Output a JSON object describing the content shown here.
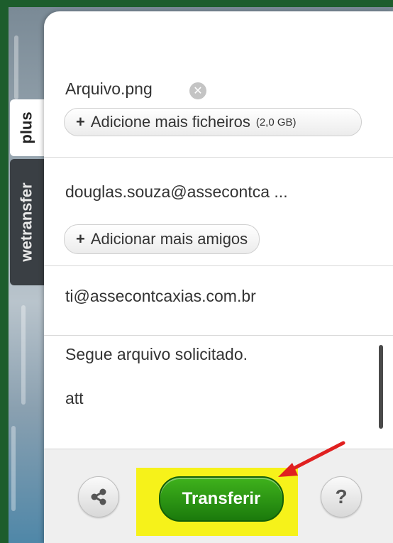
{
  "side_tabs": {
    "plus": "plus",
    "wetransfer": "wetransfer"
  },
  "files": {
    "file_name": "Arquivo.png",
    "add_label": "Adicione mais ficheiros",
    "add_prefix": "+",
    "size_limit": "(2,0 GB)"
  },
  "recipients": {
    "email": "douglas.souza@assecontca ...",
    "add_label": "Adicionar mais amigos",
    "add_prefix": "+"
  },
  "sender": {
    "email": "ti@assecontcaxias.com.br"
  },
  "message": {
    "line1": "Segue arquivo solicitado.",
    "line2": "att"
  },
  "footer": {
    "transfer_label": "Transferir",
    "help_label": "?",
    "share_icon": "share-icon"
  },
  "colors": {
    "transfer_green": "#2e9a14",
    "highlight_yellow": "#f6f21a",
    "arrow_red": "#e02020",
    "frame_green": "#1d5d2c"
  }
}
